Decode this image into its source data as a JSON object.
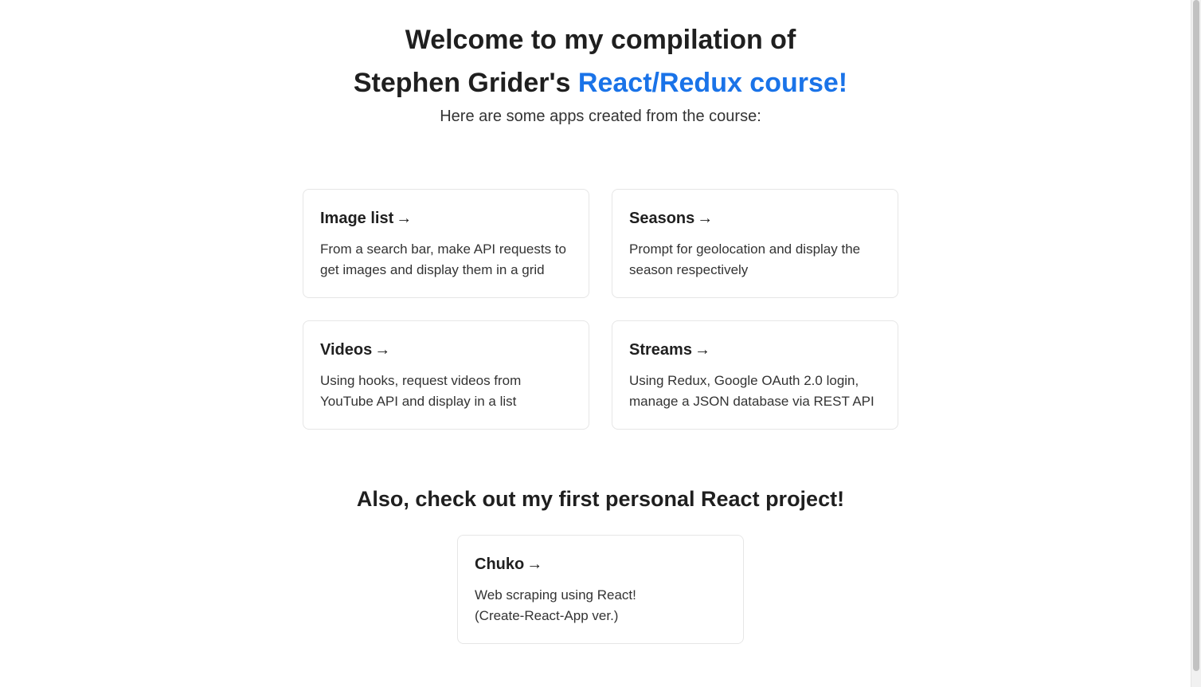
{
  "header": {
    "title_line1": "Welcome to my compilation of",
    "title_line2_prefix": "Stephen Grider's ",
    "title_line2_highlight": "React/Redux course!",
    "subtitle": "Here are some apps created from the course:"
  },
  "course_apps": [
    {
      "title": "Image list",
      "arrow": "→",
      "description": "From a search bar, make API requests to\nget images and display them in a grid"
    },
    {
      "title": "Seasons",
      "arrow": "→",
      "description": "Prompt for geolocation and display the\nseason respectively"
    },
    {
      "title": "Videos",
      "arrow": "→",
      "description": "Using hooks, request videos from\nYouTube API and display in a list"
    },
    {
      "title": "Streams",
      "arrow": "→",
      "description": "Using Redux, Google OAuth 2.0 login,\nmanage a JSON database via REST API"
    }
  ],
  "personal_section": {
    "heading": "Also, check out my first personal React project!",
    "project": {
      "title": "Chuko",
      "arrow": "→",
      "description": "Web scraping using React!\n(Create-React-App ver.)"
    }
  },
  "colors": {
    "accent": "#1a73e8",
    "text": "#1f1f1f",
    "card_border": "#e6e6e6"
  }
}
